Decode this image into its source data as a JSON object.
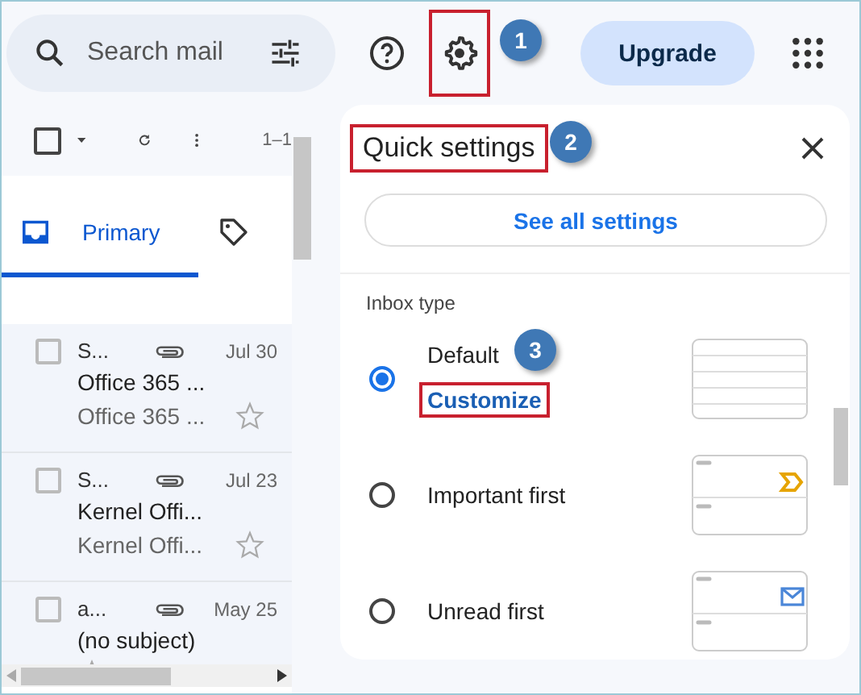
{
  "search": {
    "placeholder": "Search mail"
  },
  "settings_highlighted": true,
  "settings_callout": "1",
  "upgrade_button": "Upgrade",
  "toolbar": {
    "select_all_checked": false,
    "range": "1–1"
  },
  "tabs": [
    {
      "label": "Primary",
      "kind": "inbox",
      "selected": true
    },
    {
      "kind": "tag",
      "selected": false
    }
  ],
  "emails": [
    {
      "sender": "S...",
      "date": "Jul 30",
      "subject": "Office 365 ...",
      "snippet": "Office 365 ...",
      "attachment": true,
      "selected": false,
      "starred": false
    },
    {
      "sender": "S...",
      "date": "Jul 23",
      "subject": "Kernel Offi...",
      "snippet": "Kernel Offi...",
      "attachment": true,
      "selected": false,
      "starred": false
    },
    {
      "sender": "a...",
      "date": "May 25",
      "subject": "(no subject)",
      "attachment": true,
      "selected": false,
      "starred": false
    }
  ],
  "quick_settings": {
    "title": "Quick settings",
    "title_highlighted": true,
    "title_callout": "2",
    "see_all_button": "See all settings",
    "section_title": "Inbox type",
    "inbox_types": [
      {
        "label": "Default",
        "callout": "3",
        "link": "Customize",
        "link_highlighted": true,
        "kind": "default",
        "selected": true
      },
      {
        "label": "Important first",
        "kind": "important",
        "selected": false
      },
      {
        "label": "Unread first",
        "kind": "unread",
        "selected": false
      }
    ]
  }
}
